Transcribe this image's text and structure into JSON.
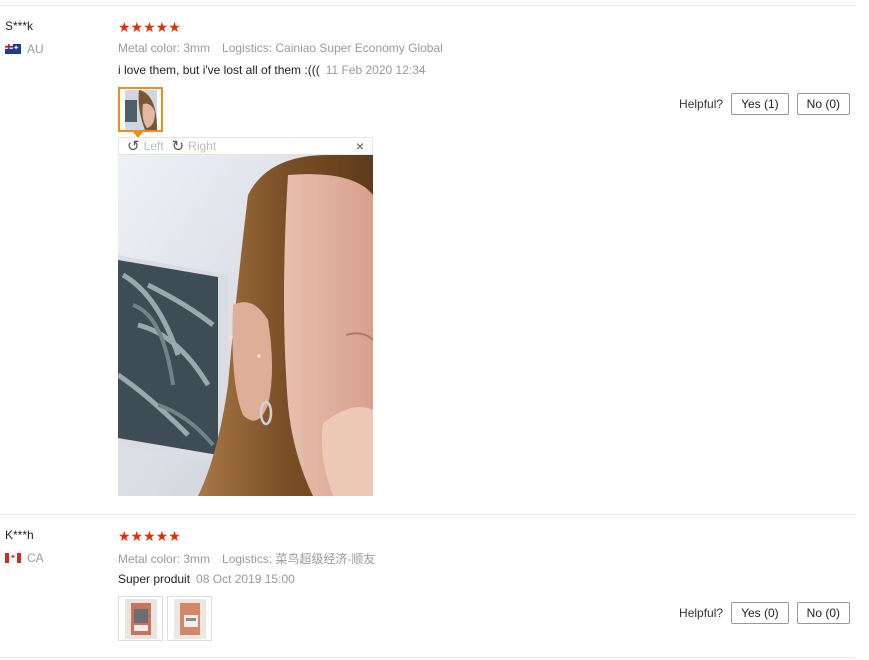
{
  "reviews": [
    {
      "user": "S***k",
      "country": "AU",
      "stars": "★★★★★",
      "metal_label": "Metal color: 3mm",
      "logistics_label": "Logistics: Cainiao Super Economy Global",
      "comment": "i love them, but i've lost all of them :(((",
      "date": "11 Feb 2020 12:34",
      "helpful_label": "Helpful?",
      "yes_label": "Yes (1)",
      "no_label": "No (0)",
      "viewer": {
        "rotate_left": "Left",
        "rotate_right": "Right",
        "close": "×"
      }
    },
    {
      "user": "K***h",
      "country": "CA",
      "stars": "★★★★★",
      "metal_label": "Metal color: 3mm",
      "logistics_label": "Logistics: 菜鸟超级经济-顺友",
      "comment": "Super produit",
      "date": "08 Oct 2019 15:00",
      "helpful_label": "Helpful?",
      "yes_label": "Yes (0)",
      "no_label": "No (0)"
    }
  ],
  "icons": {
    "rotate_left": "rotate-left-icon",
    "rotate_right": "rotate-right-icon",
    "close": "close-icon",
    "star": "star-icon"
  },
  "colors": {
    "star": "#e62e04",
    "active_thumb_border": "#f08c1a"
  }
}
